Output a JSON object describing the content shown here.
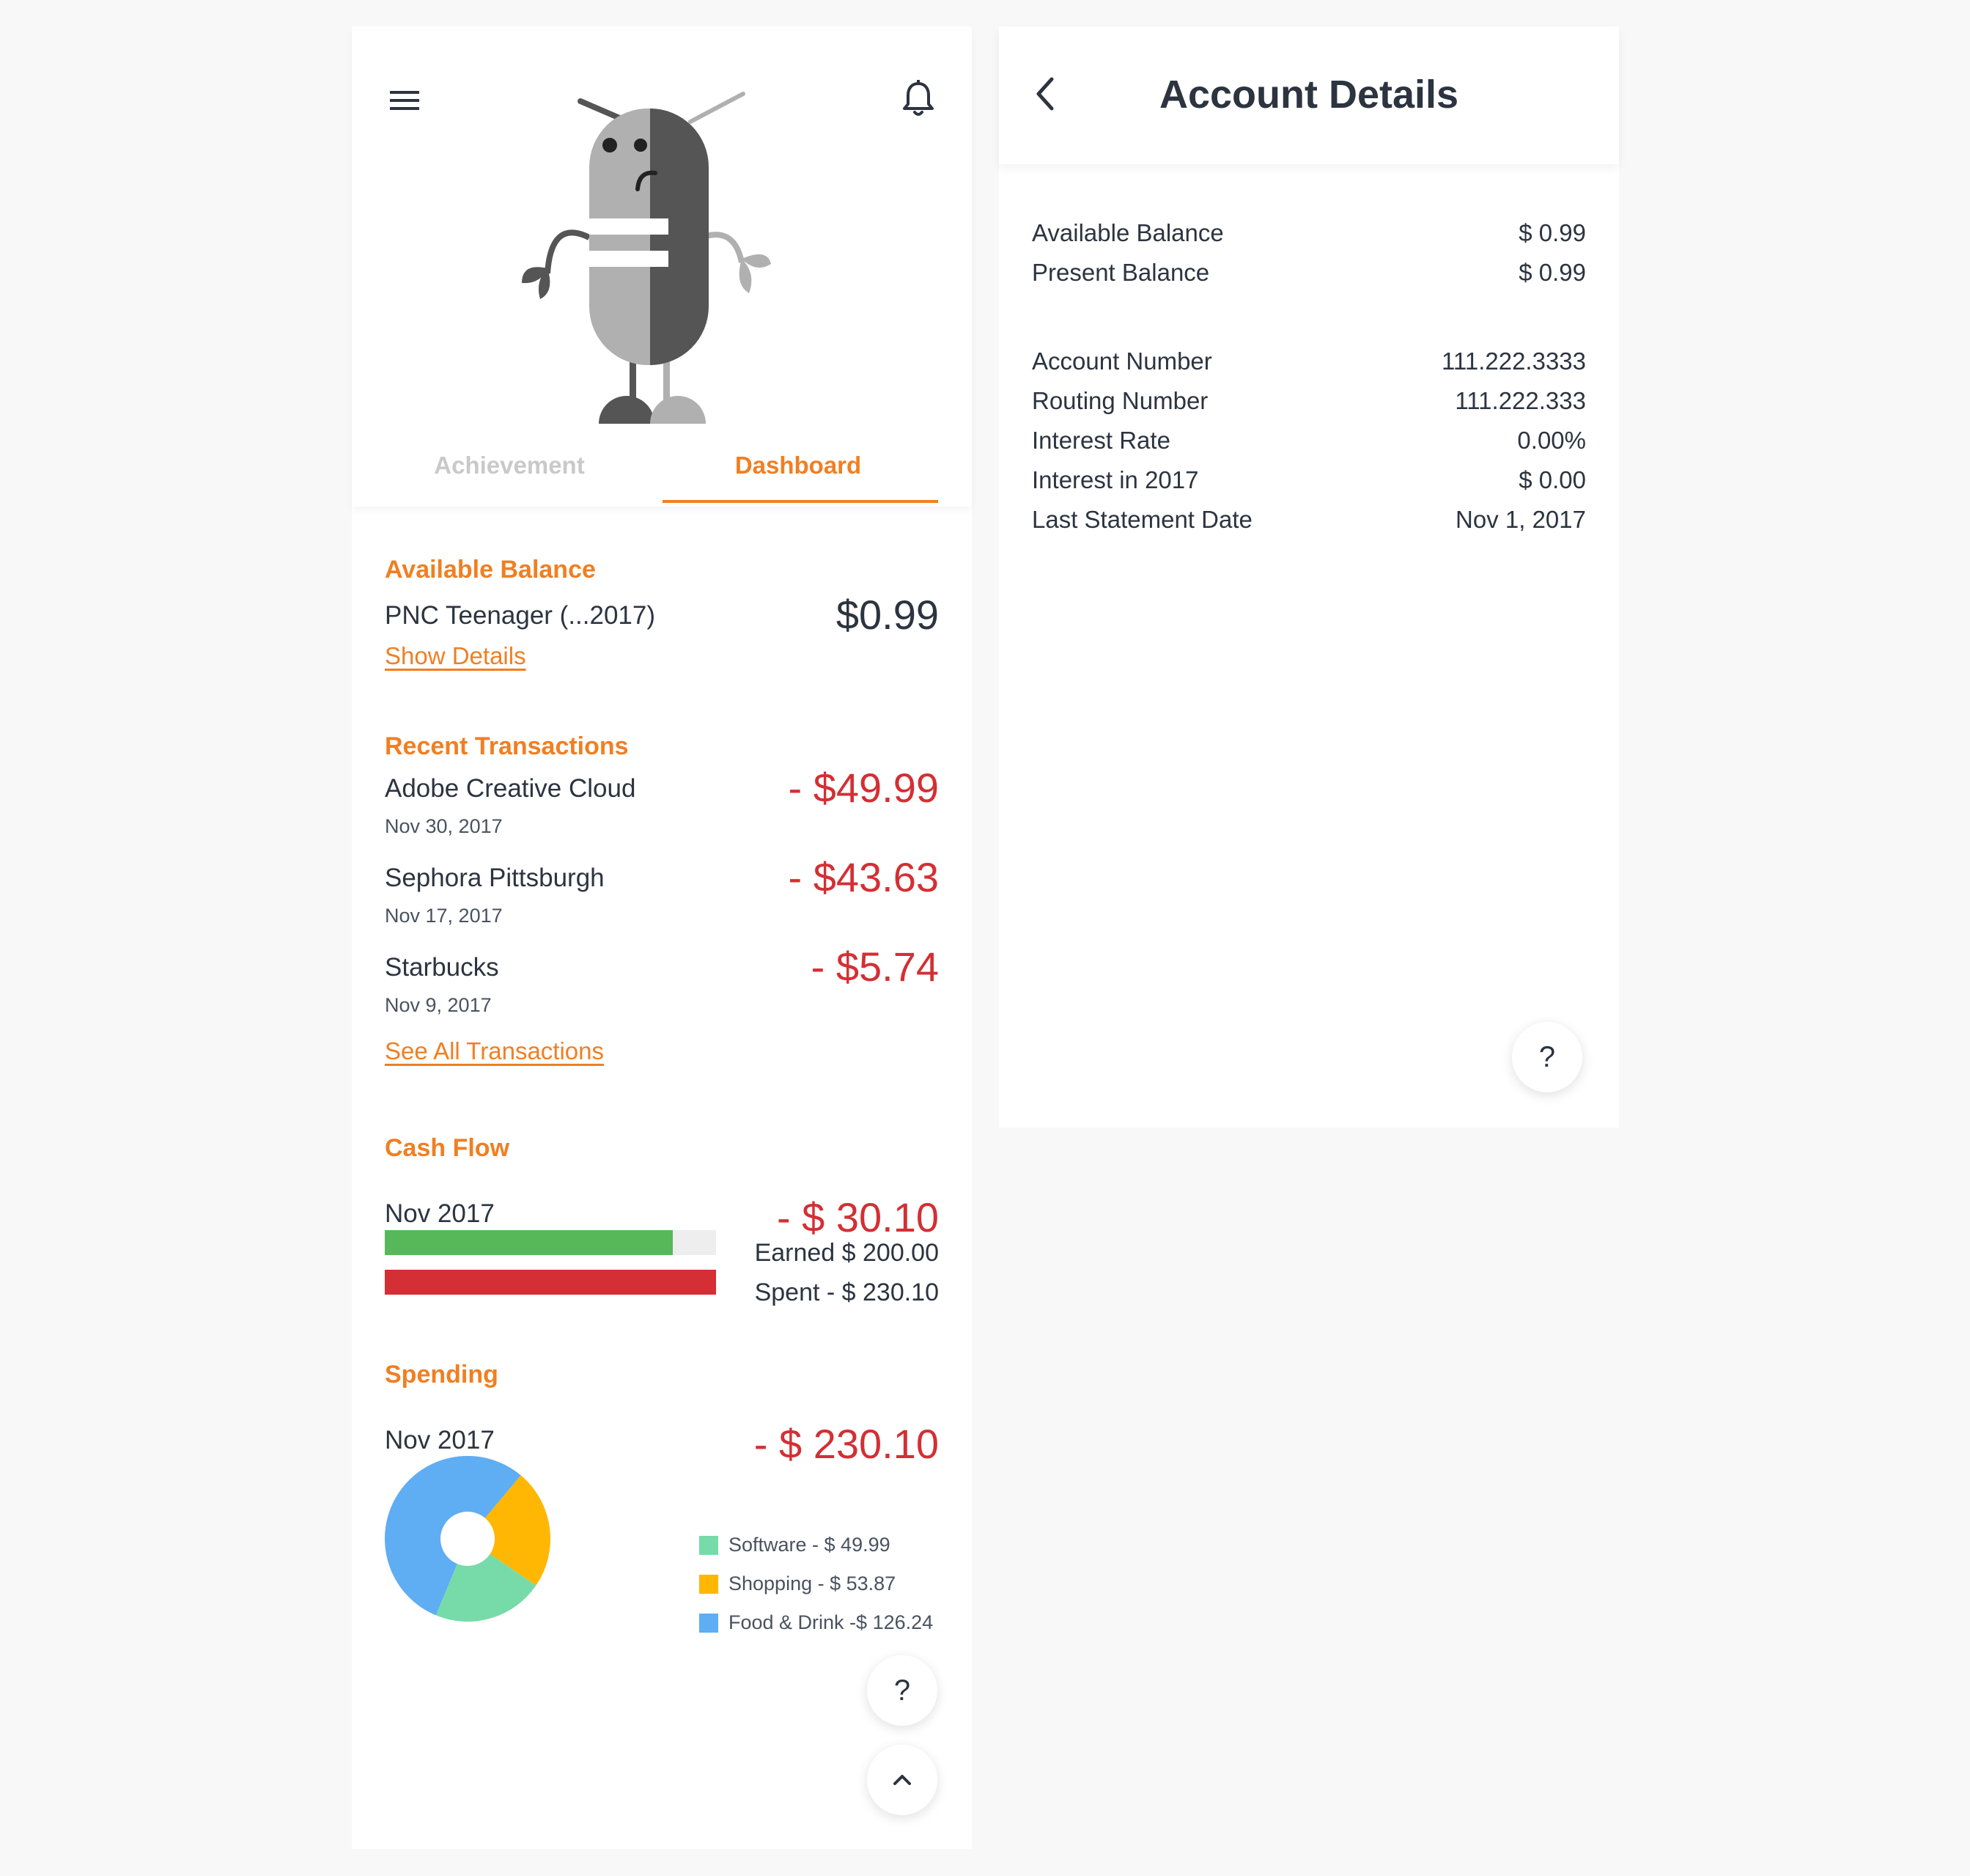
{
  "dashboard": {
    "tabs": {
      "achievement": "Achievement",
      "dashboard": "Dashboard"
    },
    "balance": {
      "heading": "Available Balance",
      "account_name": "PNC Teenager (...2017)",
      "amount": "$0.99",
      "details_link": "Show Details"
    },
    "transactions": {
      "heading": "Recent Transactions",
      "items": [
        {
          "name": "Adobe Creative Cloud",
          "date": "Nov 30, 2017",
          "amount": "- $49.99"
        },
        {
          "name": "Sephora Pittsburgh",
          "date": "Nov 17, 2017",
          "amount": "- $43.63"
        },
        {
          "name": "Starbucks",
          "date": "Nov 9, 2017",
          "amount": "- $5.74"
        }
      ],
      "see_all_link": "See All Transactions"
    },
    "cash_flow": {
      "heading": "Cash Flow",
      "period": "Nov 2017",
      "net": "- $ 30.10",
      "earned_label": "Earned $ 200.00",
      "spent_label": "Spent - $ 230.10",
      "earned_fraction": 0.87,
      "spent_fraction": 1.0,
      "earned_color": "#57b859",
      "spent_color": "#d32f34"
    },
    "spending": {
      "heading": "Spending",
      "period": "Nov 2017",
      "total": "- $ 230.10",
      "legend": [
        {
          "label": "Software - $ 49.99",
          "color": "#76dba9",
          "value": 49.99
        },
        {
          "label": "Shopping - $ 53.87",
          "color": "#ffb703",
          "value": 53.87
        },
        {
          "label": "Food & Drink -$ 126.24",
          "color": "#5fadf2",
          "value": 126.24
        }
      ]
    },
    "help_button": "?",
    "icons": {
      "menu": "menu-icon",
      "bell": "bell-icon",
      "scroll_top": "chevron-up-icon"
    }
  },
  "account_details": {
    "title": "Account Details",
    "balances": [
      {
        "label": "Available Balance",
        "value": "$ 0.99"
      },
      {
        "label": "Present Balance",
        "value": "$ 0.99"
      }
    ],
    "info": [
      {
        "label": "Account Number",
        "value": "111.222.3333"
      },
      {
        "label": "Routing Number",
        "value": "111.222.333"
      },
      {
        "label": "Interest Rate",
        "value": "0.00%"
      },
      {
        "label": "Interest in 2017",
        "value": "$ 0.00"
      },
      {
        "label": "Last Statement Date",
        "value": "Nov 1, 2017"
      }
    ],
    "help_button": "?",
    "icons": {
      "back": "chevron-left-icon"
    }
  },
  "colors": {
    "accent": "#f07f22",
    "negative": "#d32f34",
    "text": "#2c3440"
  }
}
